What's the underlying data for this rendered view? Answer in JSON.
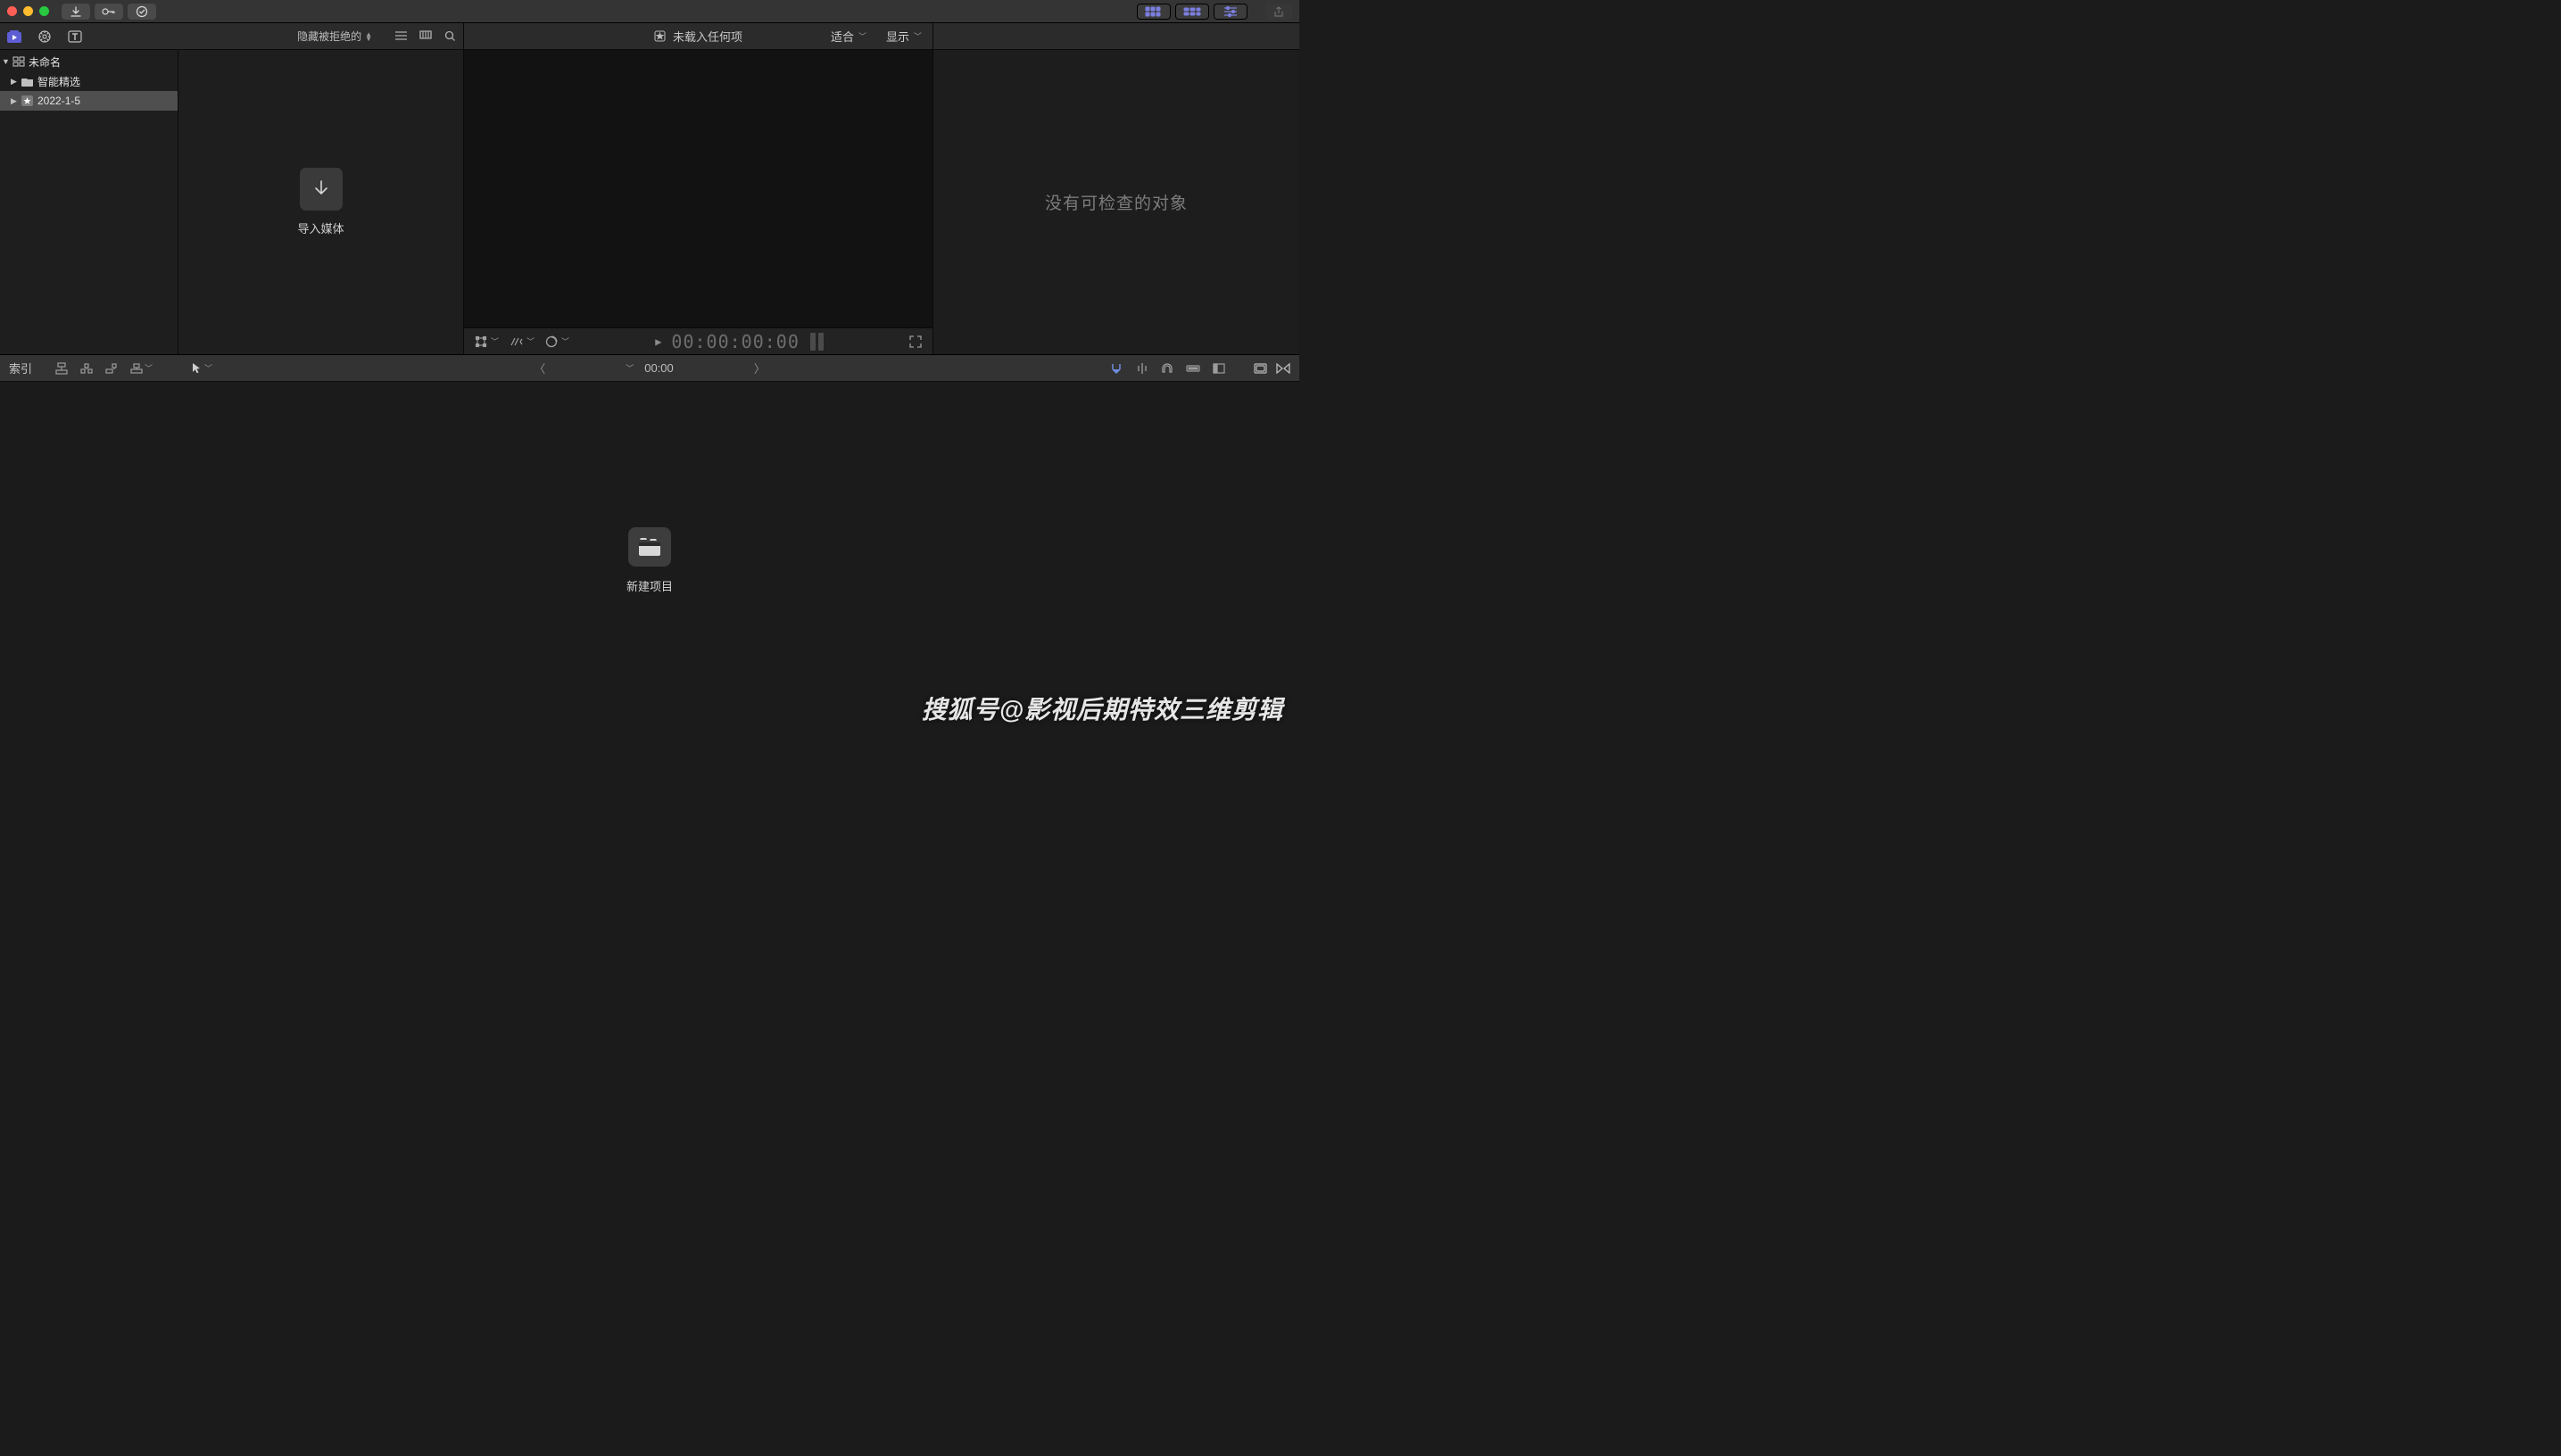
{
  "titlebar": {},
  "toolbar2": {
    "filter_label": "隐藏被拒绝的"
  },
  "viewer": {
    "title": "未载入任何项",
    "fit_label": "适合",
    "display_label": "显示",
    "timecode": "00:00:00:00"
  },
  "sidebar": {
    "root": "未命名",
    "items": [
      {
        "label": "智能精选"
      },
      {
        "label": "2022-1-5"
      }
    ]
  },
  "browser": {
    "import_label": "导入媒体"
  },
  "inspector": {
    "empty_text": "没有可检查的对象"
  },
  "timeline_toolbar": {
    "index_label": "索引",
    "time_label": "00:00"
  },
  "timeline": {
    "new_project_label": "新建项目"
  },
  "watermark": "搜狐号@影视后期特效三维剪辑"
}
